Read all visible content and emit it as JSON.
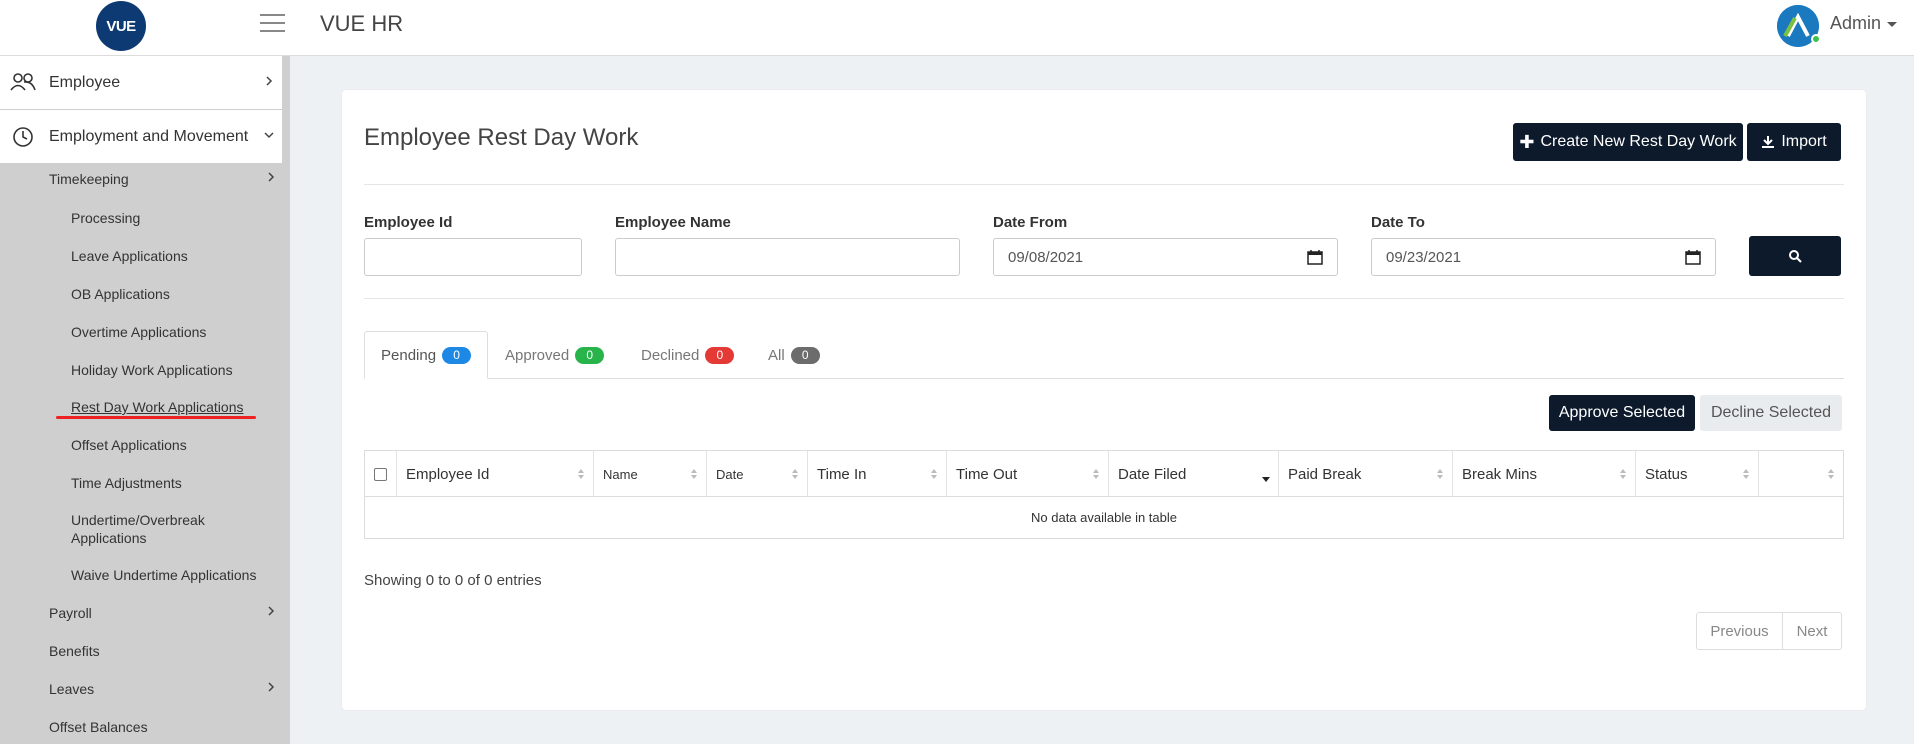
{
  "header": {
    "logo_text": "VUE",
    "app_title": "VUE HR",
    "user_name": "Admin"
  },
  "sidebar": {
    "employee": "Employee",
    "employment_movement": "Employment and Movement",
    "timekeeping": "Timekeeping",
    "timekeeping_items": [
      "Processing",
      "Leave Applications",
      "OB Applications",
      "Overtime Applications",
      "Holiday Work Applications",
      "Rest Day Work Applications",
      "Offset Applications",
      "Time Adjustments",
      "Undertime/Overbreak Applications",
      "Waive Undertime Applications"
    ],
    "payroll": "Payroll",
    "benefits": "Benefits",
    "leaves": "Leaves",
    "offset_balances": "Offset Balances"
  },
  "page": {
    "title": "Employee Rest Day Work",
    "create_button": "Create New Rest Day Work",
    "import_button": "Import"
  },
  "filters": {
    "employee_id_label": "Employee Id",
    "employee_id_value": "",
    "employee_name_label": "Employee Name",
    "employee_name_value": "",
    "date_from_label": "Date From",
    "date_from_value": "09/08/2021",
    "date_to_label": "Date To",
    "date_to_value": "09/23/2021"
  },
  "tabs": [
    {
      "label": "Pending",
      "count": "0",
      "color": "#1e88e5"
    },
    {
      "label": "Approved",
      "count": "0",
      "color": "#28b44a"
    },
    {
      "label": "Declined",
      "count": "0",
      "color": "#e53935"
    },
    {
      "label": "All",
      "count": "0",
      "color": "#6c6c6c"
    }
  ],
  "actions": {
    "approve": "Approve Selected",
    "decline": "Decline Selected"
  },
  "table": {
    "columns": [
      "Employee Id",
      "Name",
      "Date",
      "Time In",
      "Time Out",
      "Date Filed",
      "Paid Break",
      "Break Mins",
      "Status",
      ""
    ],
    "empty_message": "No data available in table"
  },
  "footer": {
    "info": "Showing 0 to 0 of 0 entries",
    "previous": "Previous",
    "next": "Next"
  }
}
